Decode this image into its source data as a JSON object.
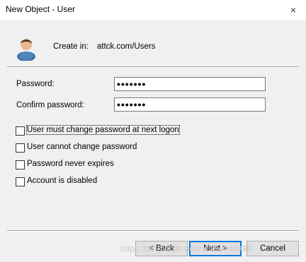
{
  "window": {
    "title": "New Object - User",
    "close_icon": "×"
  },
  "header": {
    "create_in_label": "Create in:",
    "create_in_value": "attck.com/Users"
  },
  "fields": {
    "password_label": "Password:",
    "password_value": "•••••••",
    "confirm_label": "Confirm password:",
    "confirm_value": "•••••••"
  },
  "options": [
    {
      "label": "User must change password at next logon",
      "checked": false
    },
    {
      "label": "User cannot change password",
      "checked": false
    },
    {
      "label": "Password never expires",
      "checked": false
    },
    {
      "label": "Account is disabled",
      "checked": false
    }
  ],
  "buttons": {
    "back": "< Back",
    "next": "Next >",
    "cancel": "Cancel"
  },
  "watermark": "https://blog.csdn.net/helloworld998"
}
